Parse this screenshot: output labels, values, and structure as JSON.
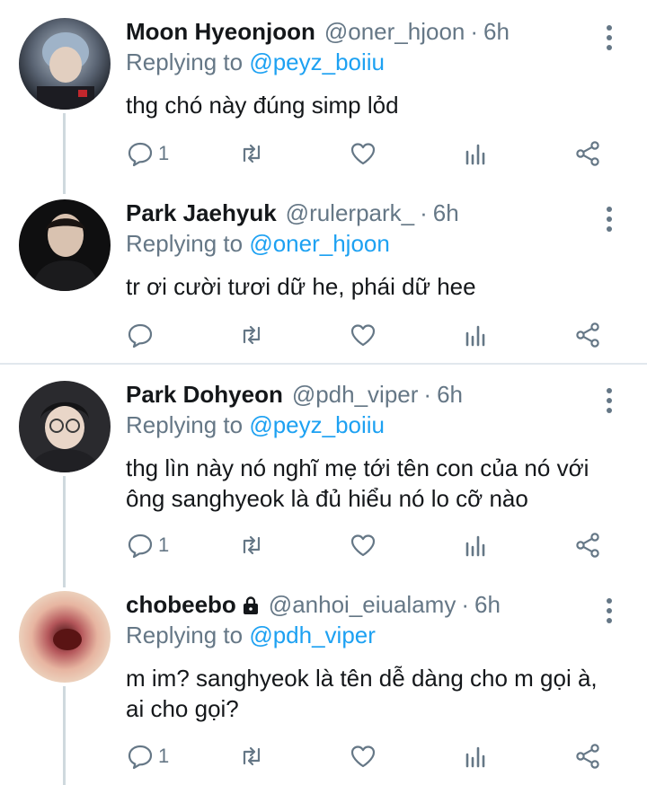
{
  "tweets": [
    {
      "name": "Moon Hyeonjoon",
      "handle": "@oner_hjoon",
      "time": "6h",
      "replying_prefix": "Replying to ",
      "replying_to": "@peyz_boiiu",
      "text": "thg chó này đúng simp lỏd",
      "reply_count": "1",
      "locked": false
    },
    {
      "name": "Park Jaehyuk",
      "handle": "@rulerpark_",
      "time": "6h",
      "replying_prefix": "Replying to ",
      "replying_to": "@oner_hjoon",
      "text": "tr ơi cười tươi dữ he, phái dữ hee",
      "reply_count": "",
      "locked": false
    },
    {
      "name": "Park Dohyeon",
      "handle": "@pdh_viper",
      "time": "6h",
      "replying_prefix": "Replying to ",
      "replying_to": "@peyz_boiiu",
      "text": "thg lìn này nó nghĩ mẹ tới tên con của nó với ông sanghyeok là đủ hiểu nó lo cỡ nào",
      "reply_count": "1",
      "locked": false
    },
    {
      "name": "chobeebo",
      "handle": "@anhoi_eiualamy",
      "time": "6h",
      "replying_prefix": "Replying to ",
      "replying_to": "@pdh_viper",
      "text": "m im? sanghyeok là tên dễ dàng cho m gọi à, ai cho gọi?",
      "reply_count": "1",
      "locked": true
    }
  ],
  "separator": "·",
  "icons": {
    "reply": "reply-icon",
    "retweet": "retweet-icon",
    "like": "heart-icon",
    "analytics": "analytics-icon",
    "share": "share-icon",
    "more": "more-vertical-icon",
    "lock": "lock-icon"
  },
  "colors": {
    "link": "#1da1f2",
    "secondary_text": "#657786",
    "primary_text": "#14171a",
    "thread_line": "#cfd9de",
    "divider": "#e1e8ed"
  }
}
